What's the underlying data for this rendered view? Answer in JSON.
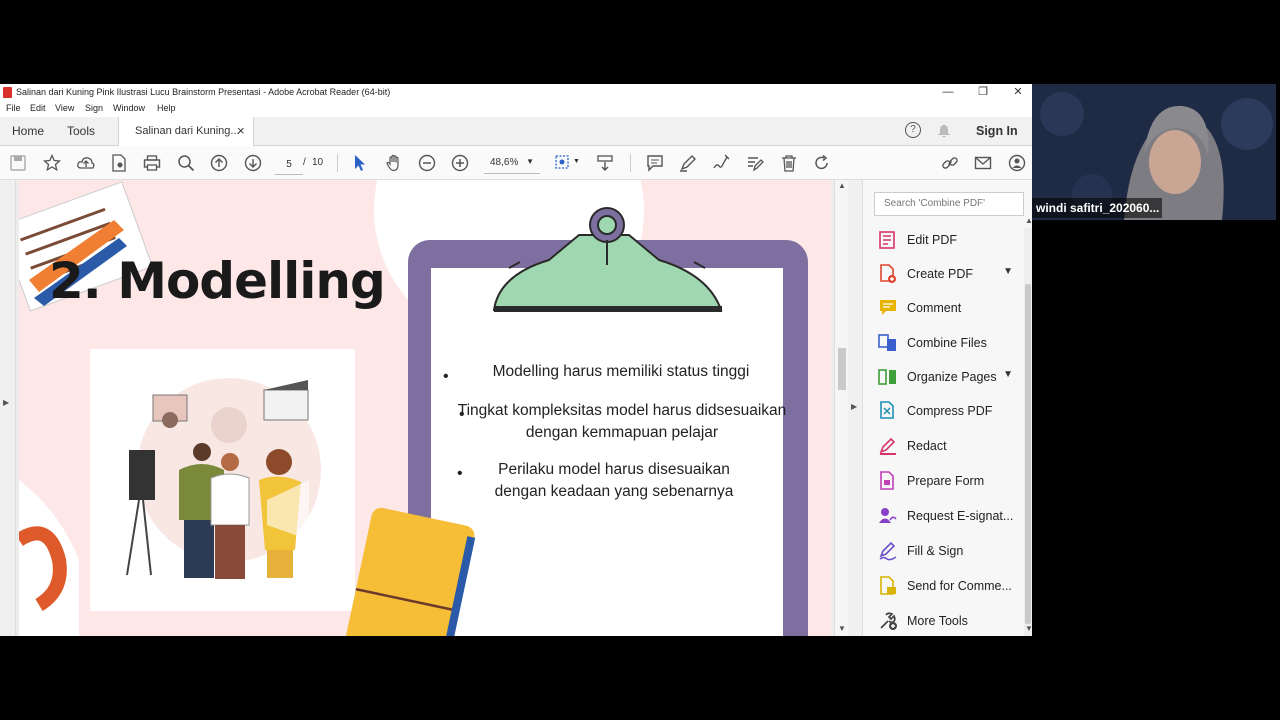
{
  "window": {
    "title": "Salinan dari Kuning Pink Ilustrasi Lucu Brainstorm Presentasi - Adobe Acrobat Reader (64-bit)",
    "controls": {
      "minimize": "—",
      "restore": "❐",
      "close": "✕"
    }
  },
  "menu": [
    "File",
    "Edit",
    "View",
    "Sign",
    "Window",
    "Help"
  ],
  "tabs": {
    "home": "Home",
    "tools": "Tools",
    "document": "Salinan dari Kuning...",
    "close": "×"
  },
  "account": {
    "sign_in": "Sign In"
  },
  "toolbar": {
    "current_page": "5",
    "page_sep": "/",
    "total_pages": "10",
    "zoom": "48,6%"
  },
  "slide": {
    "heading": "2. Modelling",
    "bullets": [
      "Modelling harus memiliki status tinggi",
      "Tingkat kompleksitas model harus didsesuaikan dengan kemmapuan pelajar",
      "Perilaku model harus disesuaikan dengan keadaan yang sebenarnya"
    ],
    "colors": {
      "background": "#fde7e7",
      "clipboard": "#7d6fa0",
      "clip": "#9fd8b0",
      "heading": "#1a1a1a"
    }
  },
  "right_pane": {
    "search_placeholder": "Search 'Combine PDF'",
    "tools": [
      {
        "label": "Edit PDF",
        "icon": "edit-pdf-icon",
        "color": "#d6336c"
      },
      {
        "label": "Create PDF",
        "icon": "create-pdf-icon",
        "color": "#e0452f"
      },
      {
        "label": "Comment",
        "icon": "comment-icon",
        "color": "#e8b400"
      },
      {
        "label": "Combine Files",
        "icon": "combine-files-icon",
        "color": "#3a5fcd"
      },
      {
        "label": "Organize Pages",
        "icon": "organize-pages-icon",
        "color": "#3f9f3a"
      },
      {
        "label": "Compress PDF",
        "icon": "compress-pdf-icon",
        "color": "#1d8fb5"
      },
      {
        "label": "Redact",
        "icon": "redact-icon",
        "color": "#d6336c"
      },
      {
        "label": "Prepare Form",
        "icon": "prepare-form-icon",
        "color": "#c13fb8"
      },
      {
        "label": "Request E-signat...",
        "icon": "request-esign-icon",
        "color": "#8a3fc7"
      },
      {
        "label": "Fill & Sign",
        "icon": "fill-sign-icon",
        "color": "#6a4fc7"
      },
      {
        "label": "Send for Comme...",
        "icon": "send-for-comment-icon",
        "color": "#d9b400"
      },
      {
        "label": "More Tools",
        "icon": "more-tools-icon",
        "color": "#444444"
      }
    ]
  },
  "webcam": {
    "participant_name": "windi safitri_202060..."
  }
}
